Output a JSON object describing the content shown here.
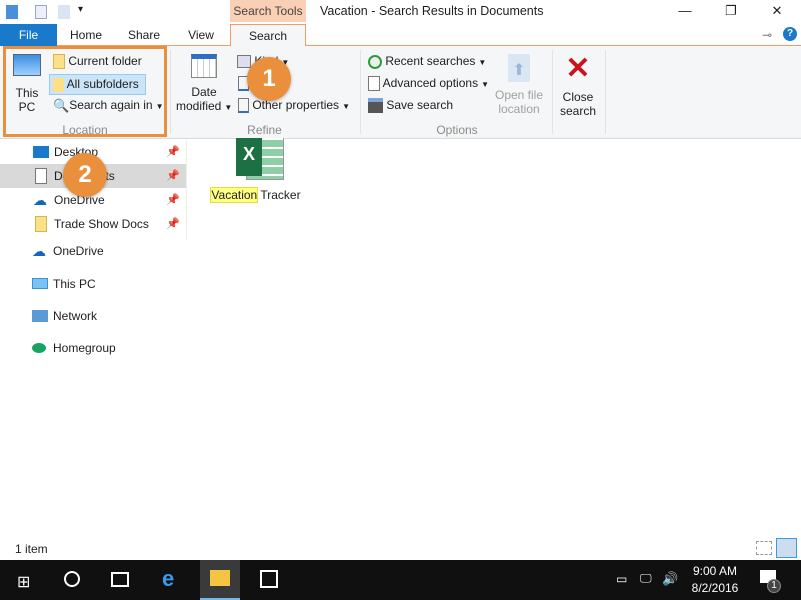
{
  "window": {
    "title": "Vacation - Search Results in Documents",
    "context_tab": "Search Tools",
    "minimize": "—",
    "maximize": "❐",
    "close": "✕"
  },
  "tabs": [
    {
      "label": "File"
    },
    {
      "label": "Home"
    },
    {
      "label": "Share"
    },
    {
      "label": "View"
    },
    {
      "label": "Search"
    }
  ],
  "ribbon": {
    "location": {
      "label": "Location",
      "this_pc": [
        "This",
        "PC"
      ],
      "current_folder": "Current folder",
      "all_subfolders": "All subfolders",
      "search_again_in": "Search again in"
    },
    "refine": {
      "label": "Refine",
      "date_modified": [
        "Date",
        "modified"
      ],
      "kind": "Kind",
      "other_properties": "Other properties"
    },
    "options": {
      "label": "Options",
      "recent_searches": "Recent searches",
      "advanced_options": "Advanced options",
      "save_search": "Save search",
      "open_file_location": [
        "Open file",
        "location"
      ]
    },
    "close_search": [
      "Close",
      "search"
    ]
  },
  "callouts": [
    "1",
    "2"
  ],
  "nav": {
    "items": [
      {
        "label": "Desktop",
        "pinned": true
      },
      {
        "label": "Documents",
        "pinned": true,
        "selected": true
      },
      {
        "label": "OneDrive",
        "pinned": true
      },
      {
        "label": "Trade Show Docs",
        "pinned": true
      },
      {
        "label": "OneDrive"
      },
      {
        "label": "This PC"
      },
      {
        "label": "Network"
      },
      {
        "label": "Homegroup"
      }
    ]
  },
  "files": [
    {
      "name_highlight": "Vacation",
      "name_rest": " Tracker",
      "type": "excel"
    }
  ],
  "status": {
    "count": "1 item"
  },
  "taskbar": {
    "time": "9:00 AM",
    "date": "8/2/2016",
    "notifications": "1"
  },
  "colors": {
    "accent": "#1979ca",
    "callout": "#ea8f3c",
    "context_tab": "#f9cfb5",
    "highlight": "#ffff80"
  }
}
